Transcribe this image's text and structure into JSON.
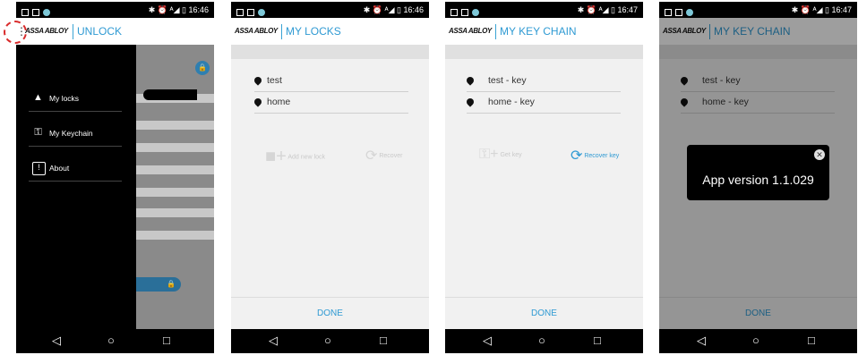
{
  "colors": {
    "accent": "#2f9ad3",
    "highlight": "#d92b2b"
  },
  "screens": [
    {
      "status": {
        "icons": "✱ ⏰ ᴬ◢ ▯",
        "time": "16:46"
      },
      "brand": "ASSA ABLOY",
      "title": "UNLOCK",
      "menu": [
        {
          "label": "My locks",
          "icon": "lock-icon"
        },
        {
          "label": "My Keychain",
          "icon": "key-icon"
        },
        {
          "label": "About",
          "icon": "info-icon"
        }
      ]
    },
    {
      "status": {
        "icons": "✱ ⏰ ᴬ◢ ▯",
        "time": "16:46"
      },
      "brand": "ASSA ABLOY",
      "title": "MY LOCKS",
      "rows": [
        "test",
        "home"
      ],
      "actions": {
        "left": "Add new lock",
        "right": "Recover"
      },
      "done": "DONE"
    },
    {
      "status": {
        "icons": "✱ ⏰ ᴬ◢ ▯",
        "time": "16:47"
      },
      "brand": "ASSA ABLOY",
      "title": "MY KEY CHAIN",
      "rows": [
        "test - key",
        "home - key"
      ],
      "actions": {
        "left": "Get key",
        "right": "Recover key"
      },
      "done": "DONE"
    },
    {
      "status": {
        "icons": "✱ ⏰ ᴬ◢ ▯",
        "time": "16:47"
      },
      "brand": "ASSA ABLOY",
      "title": "MY KEY CHAIN",
      "rows": [
        "test - key",
        "home - key"
      ],
      "dialog": "App version 1.1.029",
      "done": "DONE"
    }
  ],
  "navbar": {
    "back": "◁",
    "home": "○",
    "recents": "□"
  }
}
